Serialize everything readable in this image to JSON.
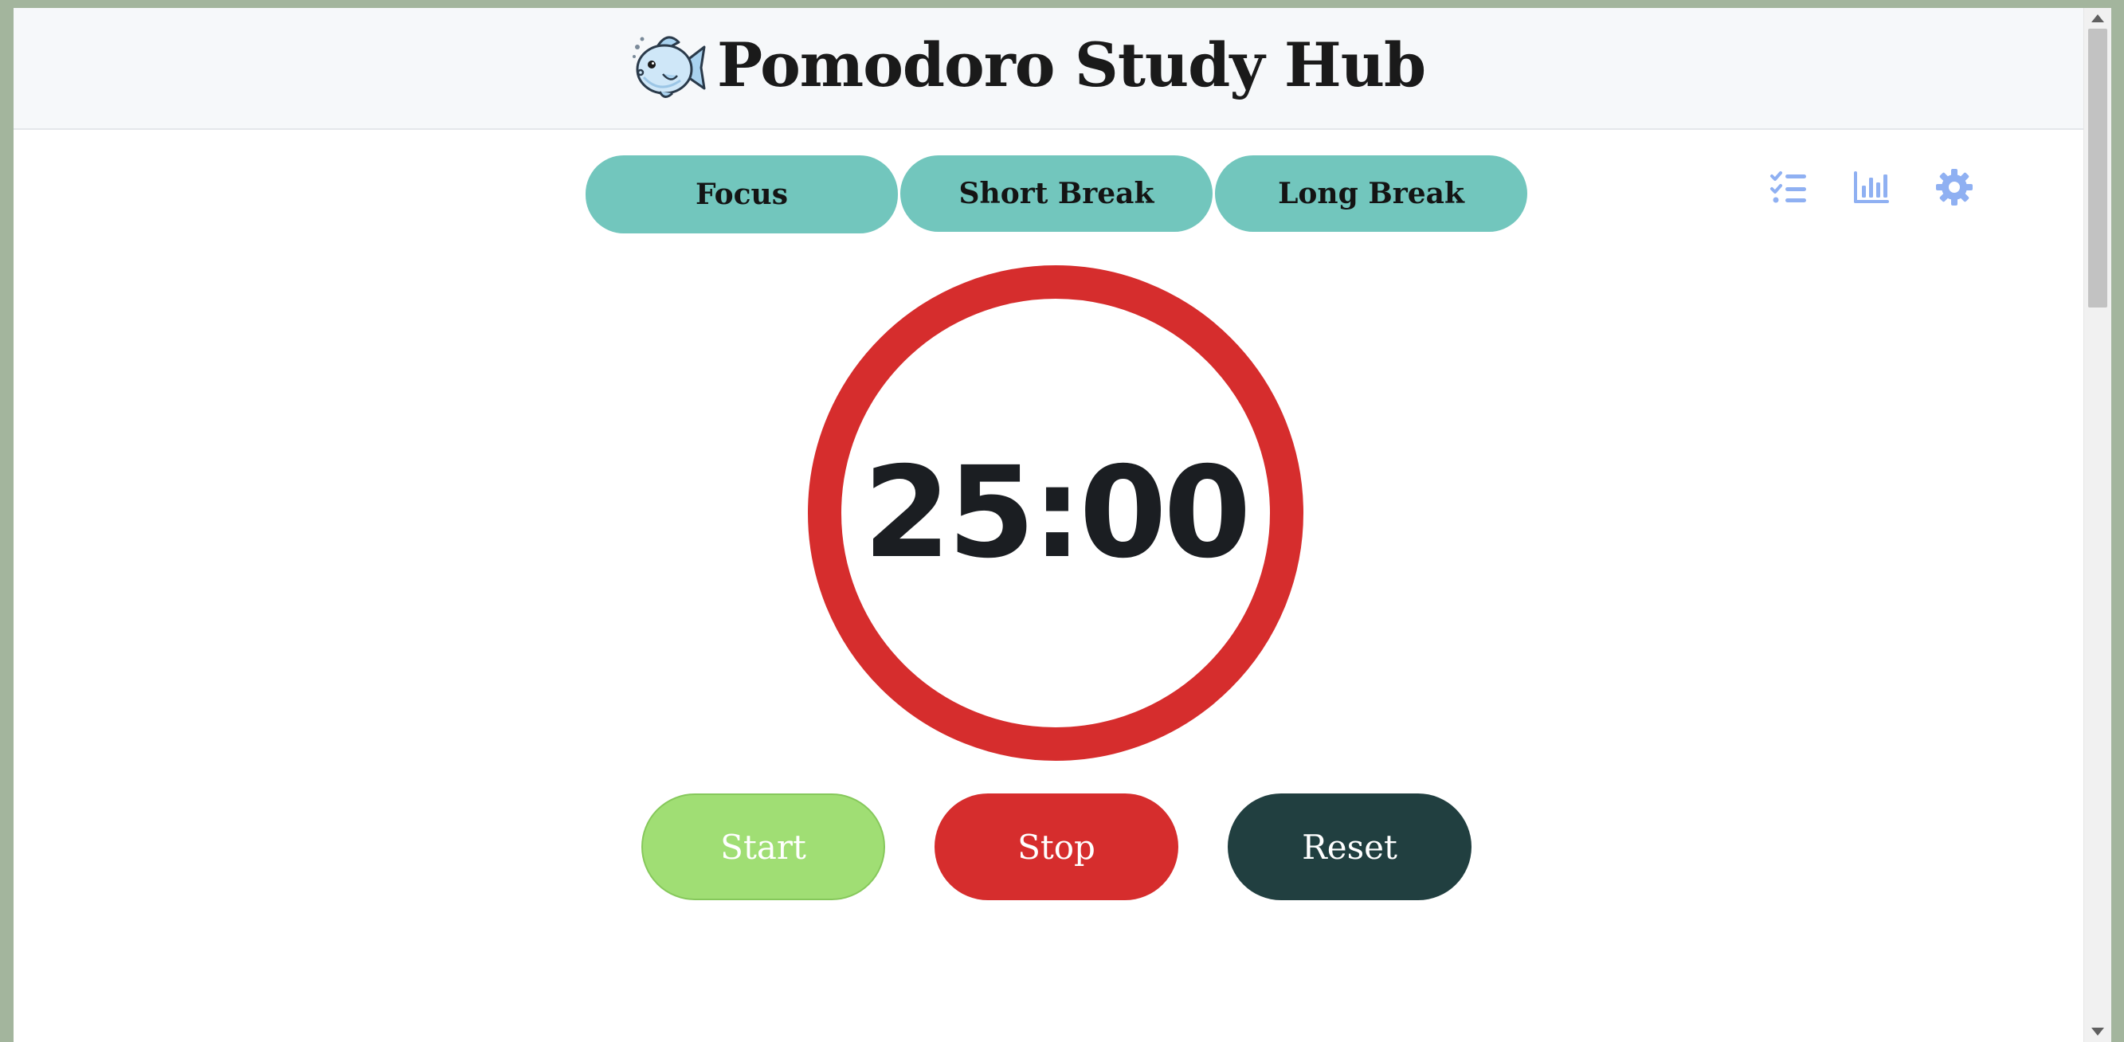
{
  "header": {
    "title": "Pomodoro Study Hub",
    "logo_icon": "fish-icon"
  },
  "tabs": [
    {
      "label": "Focus",
      "active": true
    },
    {
      "label": "Short Break",
      "active": false
    },
    {
      "label": "Long Break",
      "active": false
    }
  ],
  "toolbar": {
    "icons": [
      "task-list-icon",
      "bar-chart-icon",
      "gear-icon"
    ],
    "icon_color": "#8fb0f2"
  },
  "timer": {
    "display": "25:00",
    "ring_color": "#d62d2d"
  },
  "controls": {
    "start_label": "Start",
    "stop_label": "Stop",
    "reset_label": "Reset"
  },
  "colors": {
    "tab_bg": "#72c6bd",
    "start_bg": "#a0de74",
    "stop_bg": "#d62d2d",
    "reset_bg": "#213f40"
  }
}
